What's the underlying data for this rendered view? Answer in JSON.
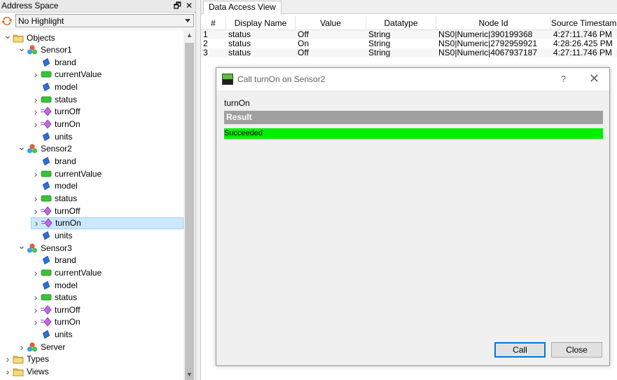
{
  "left_pane": {
    "title": "Address Space",
    "pin_glyph": "🗗",
    "close_glyph": "✕",
    "highlight_select": "No Highlight",
    "tree": [
      {
        "label": "Objects",
        "icon": "folder-icon",
        "expander": "expanded",
        "level": 0,
        "selected": false
      },
      {
        "label": "Sensor1",
        "icon": "object-icon",
        "expander": "expanded",
        "level": 1,
        "selected": false
      },
      {
        "label": "brand",
        "icon": "property-icon",
        "expander": "none",
        "level": 2,
        "selected": false
      },
      {
        "label": "currentValue",
        "icon": "variable-icon",
        "expander": "collapsed",
        "level": 2,
        "selected": false
      },
      {
        "label": "model",
        "icon": "property-icon",
        "expander": "none",
        "level": 2,
        "selected": false
      },
      {
        "label": "status",
        "icon": "variable-icon",
        "expander": "collapsed",
        "level": 2,
        "selected": false
      },
      {
        "label": "turnOff",
        "icon": "method-icon",
        "expander": "collapsed",
        "level": 2,
        "selected": false
      },
      {
        "label": "turnOn",
        "icon": "method-icon",
        "expander": "collapsed",
        "level": 2,
        "selected": false
      },
      {
        "label": "units",
        "icon": "property-icon",
        "expander": "none",
        "level": 2,
        "selected": false
      },
      {
        "label": "Sensor2",
        "icon": "object-icon",
        "expander": "expanded",
        "level": 1,
        "selected": false
      },
      {
        "label": "brand",
        "icon": "property-icon",
        "expander": "none",
        "level": 2,
        "selected": false
      },
      {
        "label": "currentValue",
        "icon": "variable-icon",
        "expander": "collapsed",
        "level": 2,
        "selected": false
      },
      {
        "label": "model",
        "icon": "property-icon",
        "expander": "none",
        "level": 2,
        "selected": false
      },
      {
        "label": "status",
        "icon": "variable-icon",
        "expander": "collapsed",
        "level": 2,
        "selected": false
      },
      {
        "label": "turnOff",
        "icon": "method-icon",
        "expander": "collapsed",
        "level": 2,
        "selected": false
      },
      {
        "label": "turnOn",
        "icon": "method-icon",
        "expander": "collapsed",
        "level": 2,
        "selected": true
      },
      {
        "label": "units",
        "icon": "property-icon",
        "expander": "none",
        "level": 2,
        "selected": false
      },
      {
        "label": "Sensor3",
        "icon": "object-icon",
        "expander": "expanded",
        "level": 1,
        "selected": false
      },
      {
        "label": "brand",
        "icon": "property-icon",
        "expander": "none",
        "level": 2,
        "selected": false
      },
      {
        "label": "currentValue",
        "icon": "variable-icon",
        "expander": "collapsed",
        "level": 2,
        "selected": false
      },
      {
        "label": "model",
        "icon": "property-icon",
        "expander": "none",
        "level": 2,
        "selected": false
      },
      {
        "label": "status",
        "icon": "variable-icon",
        "expander": "collapsed",
        "level": 2,
        "selected": false
      },
      {
        "label": "turnOff",
        "icon": "method-icon",
        "expander": "collapsed",
        "level": 2,
        "selected": false
      },
      {
        "label": "turnOn",
        "icon": "method-icon",
        "expander": "collapsed",
        "level": 2,
        "selected": false
      },
      {
        "label": "units",
        "icon": "property-icon",
        "expander": "none",
        "level": 2,
        "selected": false
      },
      {
        "label": "Server",
        "icon": "object-icon",
        "expander": "collapsed",
        "level": 1,
        "selected": false
      },
      {
        "label": "Types",
        "icon": "folder-icon",
        "expander": "collapsed",
        "level": 0,
        "selected": false
      },
      {
        "label": "Views",
        "icon": "folder-icon",
        "expander": "collapsed",
        "level": 0,
        "selected": false
      }
    ]
  },
  "data_access": {
    "tab_label": "Data Access View",
    "columns": [
      "#",
      "Display Name",
      "Value",
      "Datatype",
      "Node Id",
      "Source Timestamp"
    ],
    "rows": [
      [
        "1",
        "status",
        "Off",
        "String",
        "NS0|Numeric|390199368",
        "4:27:11.746 PM"
      ],
      [
        "2",
        "status",
        "On",
        "String",
        "NS0|Numeric|2792959921",
        "4:28:26.425 PM"
      ],
      [
        "3",
        "status",
        "Off",
        "String",
        "NS0|Numeric|4067937187",
        "4:27:11.746 PM"
      ]
    ]
  },
  "dialog": {
    "title": "Call turnOn on Sensor2",
    "help_glyph": "?",
    "close_glyph": "✕",
    "method_name": "turnOn",
    "result_header": "Result",
    "result_value": "Succeeded",
    "call_label": "Call",
    "close_label": "Close"
  },
  "colors": {
    "success": "#00f000",
    "selection": "#cce8ff",
    "result_header": "#a0a0a0",
    "accent": "#0078d7"
  }
}
